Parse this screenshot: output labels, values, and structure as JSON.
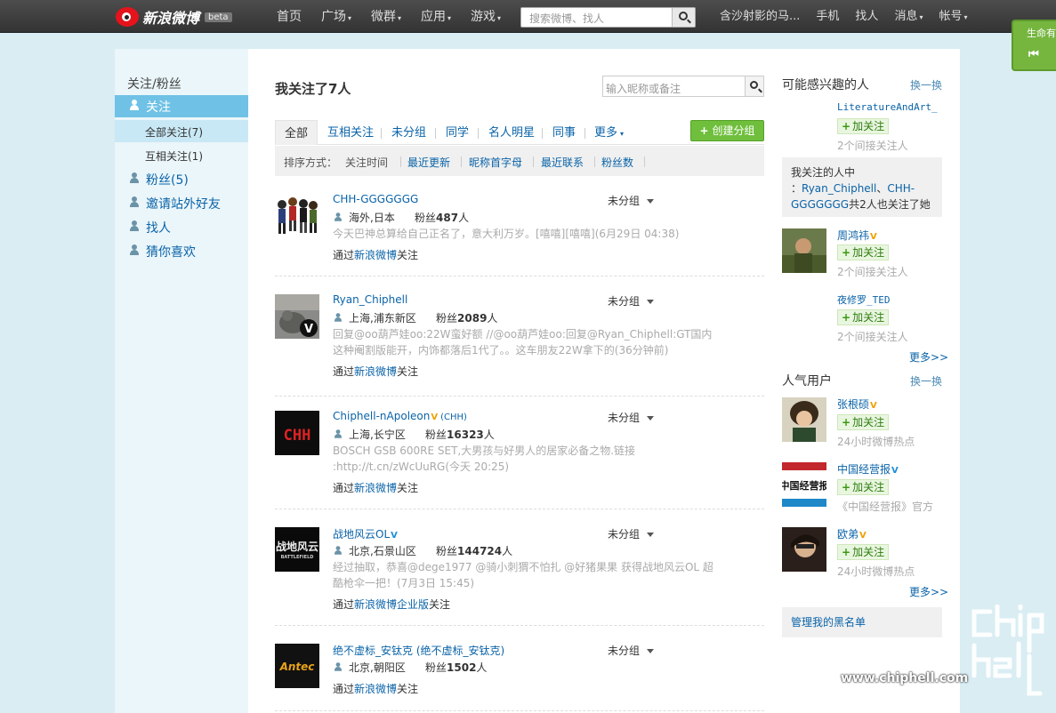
{
  "topbar": {
    "logo_text": "新浪微博",
    "beta": "beta",
    "nav": [
      "首页",
      "广场",
      "微群",
      "应用",
      "游戏"
    ],
    "nav_dropdown": [
      false,
      true,
      true,
      true,
      true
    ],
    "search_placeholder": "搜索微博、找人",
    "user": "含沙射影的马...",
    "right_nav": [
      "手机",
      "找人",
      "消息",
      "帐号"
    ],
    "right_nav_dropdown": [
      false,
      false,
      true,
      true
    ],
    "life_tab": "生命有"
  },
  "sidebar": {
    "heading": "关注/粉丝",
    "items": [
      {
        "label": "关注"
      },
      {
        "label": "全部关注(7)"
      },
      {
        "label": "互相关注(1)"
      },
      {
        "label": "粉丝(5)"
      },
      {
        "label": "邀请站外好友"
      },
      {
        "label": "找人"
      },
      {
        "label": "猜你喜欢"
      }
    ]
  },
  "main": {
    "title": "我关注了7人",
    "search_placeholder": "输入昵称或备注",
    "tabs": [
      "全部",
      "互相关注",
      "未分组",
      "同学",
      "名人明星",
      "同事",
      "更多"
    ],
    "create_group": "创建分组",
    "sort_label": "排序方式：",
    "sorts": [
      "关注时间",
      "最近更新",
      "昵称首字母",
      "最近联系",
      "粉丝数"
    ],
    "rows": [
      {
        "name": "CHH-GGGGGGG",
        "badge": "",
        "extra": "",
        "group": "未分组",
        "location": "海外,日本",
        "fans_label": "粉丝",
        "fans": "487",
        "fans_unit": "人",
        "status": "今天巴神总算给自己正名了，意大利万岁。[嘻嘻][嘻嘻](6月29日 04:38)",
        "status2": "",
        "via_pre": "通过",
        "via_link": "新浪微博",
        "via_post": "关注"
      },
      {
        "name": "Ryan_Chiphell",
        "badge": "",
        "extra": "",
        "group": "未分组",
        "location": "上海,浦东新区",
        "fans_label": "粉丝",
        "fans": "2089",
        "fans_unit": "人",
        "status": "回复@oo葫芦娃oo:22W蛮好额 //@oo葫芦娃oo:回复@Ryan_Chiphell:GT国内",
        "status2": "这种阉割版能开，内饰都落后1代了。。这车朋友22W拿下的(36分钟前)",
        "via_pre": "通过",
        "via_link": "新浪微博",
        "via_post": "关注"
      },
      {
        "name": "Chiphell-nApoleon",
        "badge": "gold",
        "extra": "(CHH)",
        "group": "未分组",
        "location": "上海,长宁区",
        "fans_label": "粉丝",
        "fans": "16323",
        "fans_unit": "人",
        "status": "BOSCH GSB 600RE SET,大男孩与好男人的居家必备之物.链接",
        "status2": ":http://t.cn/zWcUuRG(今天 20:25)",
        "via_pre": "通过",
        "via_link": "新浪微博",
        "via_post": "关注"
      },
      {
        "name": "战地风云OL",
        "badge": "blue",
        "extra": "",
        "group": "未分组",
        "location": "北京,石景山区",
        "fans_label": "粉丝",
        "fans": "144724",
        "fans_unit": "人",
        "status": "经过抽取，恭喜@dege1977 @骑小刺猬不怕扎 @好猪果果 获得战地风云OL 超",
        "status2": "酷枪伞一把！(7月3日 15:45)",
        "via_pre": "通过",
        "via_link": "新浪微博企业版",
        "via_post": "关注"
      },
      {
        "name": "绝不虚标_安钛克 (绝不虚标_安钛克)",
        "badge": "",
        "extra": "",
        "group": "未分组",
        "location": "北京,朝阳区",
        "fans_label": "粉丝",
        "fans": "1502",
        "fans_unit": "人",
        "status": "",
        "status2": "",
        "via_pre": "通过",
        "via_link": "新浪微博",
        "via_post": "关注"
      }
    ]
  },
  "right": {
    "maybe_title": "可能感兴趣的人",
    "change": "换一换",
    "add_label": "加关注",
    "suggest": [
      {
        "name": "LiteratureAndArt_",
        "badge": "",
        "note": "2个间接关注人"
      },
      {
        "name": "周鸿祎",
        "badge": "gold",
        "note": "2个间接关注人"
      },
      {
        "name": "夜修罗_TED",
        "badge": "",
        "note": "2个间接关注人"
      }
    ],
    "info_pre": "我关注的人中",
    "info_colon": "：",
    "info_link1": "Ryan_Chiphell",
    "info_mid": "、",
    "info_link2a": "CHH-",
    "info_link2b": "GGGGGGG",
    "info_post": "共2人也关注了她",
    "more": "更多>>",
    "popular_title": "人气用户",
    "popular": [
      {
        "name": "张根硕",
        "badge": "gold",
        "note": "24小时微博热点"
      },
      {
        "name": "中国经营报",
        "badge": "blue",
        "note": "《中国经营报》官方"
      },
      {
        "name": "欧弟",
        "badge": "gold",
        "note": "24小时微博热点"
      }
    ],
    "blacklist": "管理我的黑名单"
  },
  "watermark": {
    "text": "chip hell",
    "url": "www.chiphell.com"
  }
}
